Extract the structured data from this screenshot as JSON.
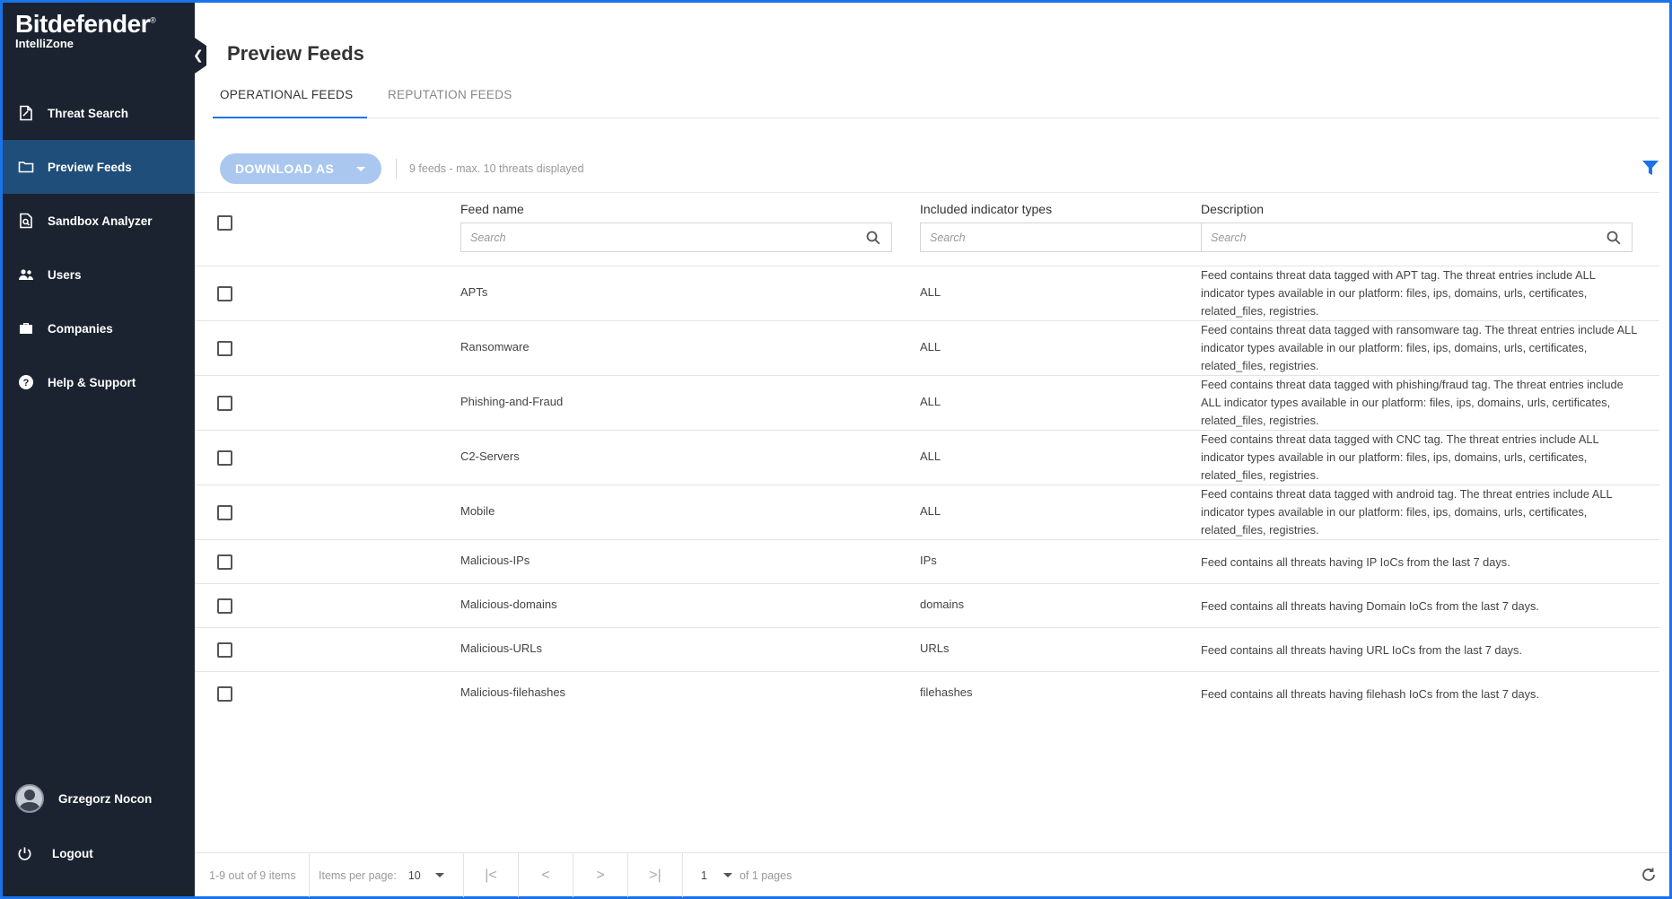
{
  "brand": {
    "name": "Bitdefender",
    "mark": "®",
    "product": "IntelliZone"
  },
  "sidebar": {
    "items": [
      {
        "label": "Threat Search",
        "icon": "document-search-icon",
        "active": false
      },
      {
        "label": "Preview Feeds",
        "icon": "folder-icon",
        "active": true
      },
      {
        "label": "Sandbox Analyzer",
        "icon": "file-search-icon",
        "active": false
      },
      {
        "label": "Users",
        "icon": "users-icon",
        "active": false
      },
      {
        "label": "Companies",
        "icon": "briefcase-icon",
        "active": false
      },
      {
        "label": "Help & Support",
        "icon": "help-icon",
        "active": false
      }
    ],
    "user_name": "Grzegorz Nocon",
    "logout_label": "Logout"
  },
  "page": {
    "title": "Preview Feeds"
  },
  "tabs": [
    {
      "label": "OPERATIONAL FEEDS",
      "active": true
    },
    {
      "label": "REPUTATION FEEDS",
      "active": false
    }
  ],
  "toolbar": {
    "download_label": "DOWNLOAD AS",
    "feeds_count": "9 feeds - max. 10 threats displayed"
  },
  "table": {
    "columns": [
      {
        "label": "Feed name",
        "search_placeholder": "Search"
      },
      {
        "label": "Included indicator types",
        "search_placeholder": "Search"
      },
      {
        "label": "Description",
        "search_placeholder": "Search"
      }
    ],
    "rows": [
      {
        "name": "APTs",
        "types": "ALL",
        "description": "Feed contains threat data tagged with APT tag. The threat entries include ALL indicator types available in our platform: files, ips, domains, urls, certificates, related_files, registries."
      },
      {
        "name": "Ransomware",
        "types": "ALL",
        "description": "Feed contains threat data tagged with ransomware tag. The threat entries include ALL indicator types available in our platform: files, ips, domains, urls, certificates, related_files, registries."
      },
      {
        "name": "Phishing-and-Fraud",
        "types": "ALL",
        "description": "Feed contains threat data tagged with phishing/fraud tag. The threat entries include ALL indicator types available in our platform: files, ips, domains, urls, certificates, related_files, registries."
      },
      {
        "name": "C2-Servers",
        "types": "ALL",
        "description": "Feed contains threat data tagged with CNC tag. The threat entries include ALL indicator types available in our platform: files, ips, domains, urls, certificates, related_files, registries."
      },
      {
        "name": "Mobile",
        "types": "ALL",
        "description": "Feed contains threat data tagged with android tag. The threat entries include ALL indicator types available in our platform: files, ips, domains, urls, certificates, related_files, registries."
      },
      {
        "name": "Malicious-IPs",
        "types": "IPs",
        "description": "Feed contains all threats having IP IoCs from the last 7 days."
      },
      {
        "name": "Malicious-domains",
        "types": "domains",
        "description": "Feed contains all threats having Domain IoCs from the last 7 days."
      },
      {
        "name": "Malicious-URLs",
        "types": "URLs",
        "description": "Feed contains all threats having URL IoCs from the last 7 days."
      },
      {
        "name": "Malicious-filehashes",
        "types": "filehashes",
        "description": "Feed contains all threats having filehash IoCs from the last 7 days."
      }
    ]
  },
  "pagination": {
    "range": "1-9 out of 9 items",
    "items_per_page_label": "Items per page:",
    "items_per_page_value": "10",
    "first": "|<",
    "prev": "<",
    "next": ">",
    "last": ">|",
    "current_page": "1",
    "of_pages": "of 1 pages"
  },
  "colors": {
    "accent": "#1a73e8",
    "sidebar_bg": "#1b2330",
    "sidebar_active": "#1f4e7a",
    "download_btn": "#aac8ef"
  }
}
